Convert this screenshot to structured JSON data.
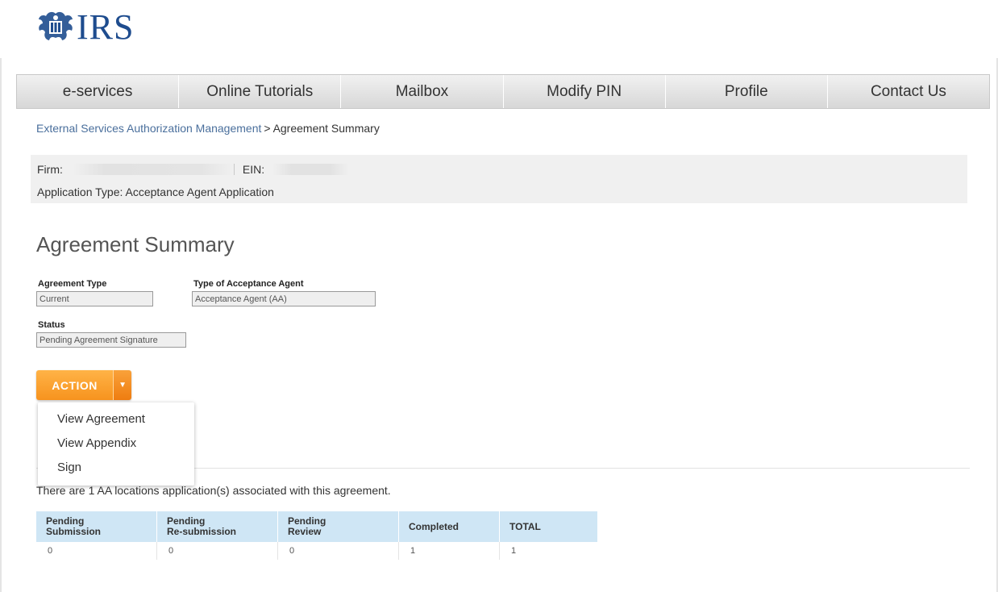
{
  "logo": {
    "text": "IRS",
    "alt": "eagle-logo"
  },
  "nav": {
    "items": [
      {
        "label": "e-services"
      },
      {
        "label": "Online Tutorials"
      },
      {
        "label": "Mailbox"
      },
      {
        "label": "Modify PIN"
      },
      {
        "label": "Profile"
      },
      {
        "label": "Contact Us"
      }
    ]
  },
  "breadcrumb": {
    "parent": "External Services Authorization Management",
    "separator": ">",
    "current": "Agreement Summary"
  },
  "firm_info": {
    "firm_label": "Firm:",
    "ein_label": "EIN:",
    "application_type": "Application Type: Acceptance Agent Application"
  },
  "page_title": "Agreement Summary",
  "fields": {
    "agreement_type": {
      "label": "Agreement Type",
      "value": "Current"
    },
    "acceptance_agent_type": {
      "label": "Type of Acceptance Agent",
      "value": "Acceptance Agent (AA)"
    },
    "status": {
      "label": "Status",
      "value": "Pending Agreement Signature"
    }
  },
  "action": {
    "label": "ACTION",
    "caret": "▼",
    "menu": [
      {
        "label": "View Agreement"
      },
      {
        "label": "View Appendix"
      },
      {
        "label": "Sign"
      }
    ]
  },
  "locations": {
    "summary_text": "There are 1 AA locations application(s) associated with this agreement.",
    "headers": [
      {
        "line1": "Pending",
        "line2": "Submission"
      },
      {
        "line1": "Pending",
        "line2": "Re-submission"
      },
      {
        "line1": "Pending",
        "line2": "Review"
      },
      {
        "line1": "Completed",
        "line2": ""
      },
      {
        "line1": "TOTAL",
        "line2": ""
      }
    ],
    "values": [
      "0",
      "0",
      "0",
      "1",
      "1"
    ]
  },
  "colors": {
    "accent_orange": "#f7931e",
    "link_blue": "#4a6f9c",
    "table_header": "#cfe6f5",
    "logo_blue": "#1e4c8e"
  }
}
